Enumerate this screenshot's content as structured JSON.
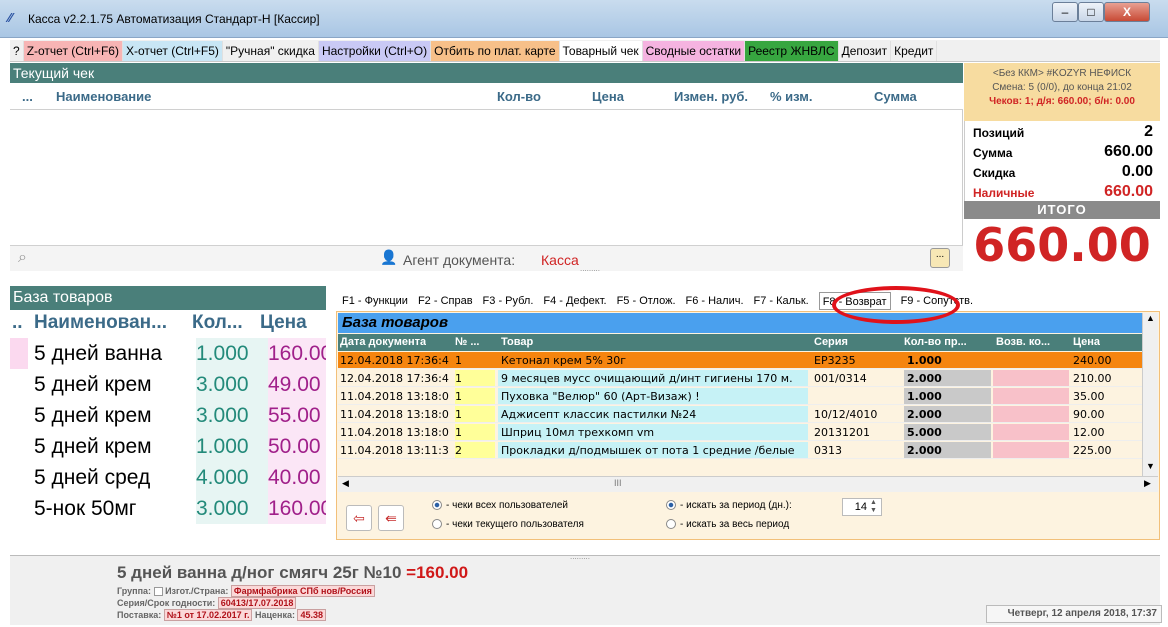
{
  "window": {
    "title": "Касса v2.2.1.75 Автоматизация Стандарт-Н [Кассир]",
    "icon": "app-logo-icon",
    "min": "–",
    "max": "□",
    "close": "X"
  },
  "toolbar": [
    {
      "label": "?",
      "color": "#f0f0f0"
    },
    {
      "label": "Z-отчет (Ctrl+F6)",
      "color": "#f7b4b4"
    },
    {
      "label": "X-отчет (Ctrl+F5)",
      "color": "#c8e6f5"
    },
    {
      "label": "\"Ручная\" скидка",
      "color": "#f0f0f0"
    },
    {
      "label": "Настройки (Ctrl+O)",
      "color": "#c9c9f5"
    },
    {
      "label": "Отбить по плат. карте",
      "color": "#f7c089"
    },
    {
      "label": "Товарный чек",
      "color": "#ffffff"
    },
    {
      "label": "Сводные остатки",
      "color": "#f5b3e0"
    },
    {
      "label": "Реестр ЖНВЛС",
      "color": "#37a640"
    },
    {
      "label": "Депозит",
      "color": "#f0f0f0"
    },
    {
      "label": "Кредит",
      "color": "#f0f0f0"
    }
  ],
  "current": {
    "title": "Текущий чек",
    "cols": {
      "dots": "...",
      "name": "Наименование",
      "qty": "Кол-во",
      "price": "Цена",
      "chg": "Измен. руб.",
      "pct": "% изм.",
      "sum": "Сумма"
    },
    "agent_label": "Агент документа:",
    "agent_value": "Касса",
    "more": "...",
    "splitter": "........."
  },
  "shift": {
    "line1": "<Без ККМ> #KOZYR НЕФИСК",
    "line2": "Смена: 5 (0/0), до конца 21:02",
    "line3": "Чеков: 1; д/я: 660.00; б/н: 0.00"
  },
  "totals": {
    "positions_l": "Позиций",
    "positions_v": "2",
    "sum_l": "Сумма",
    "sum_v": "660.00",
    "disc_l": "Скидка",
    "disc_v": "0.00",
    "cash_l": "Наличные",
    "cash_v": "660.00",
    "itogo_l": "ИТОГО",
    "itogo_v": "660.00"
  },
  "base": {
    "title": "База товаров",
    "cols": {
      "dots": "..",
      "name": "Наименован...",
      "qty": "Кол...",
      "price": "Цена"
    },
    "rows": [
      {
        "name": "5 дней ванна",
        "qty": "1.000",
        "price": "160.00"
      },
      {
        "name": "5 дней крем",
        "qty": "3.000",
        "price": "49.00"
      },
      {
        "name": "5 дней крем",
        "qty": "3.000",
        "price": "55.00"
      },
      {
        "name": "5 дней крем",
        "qty": "1.000",
        "price": "50.00"
      },
      {
        "name": "5 дней сред",
        "qty": "4.000",
        "price": "40.00"
      },
      {
        "name": "5-нок 50мг",
        "qty": "3.000",
        "price": "160.00"
      }
    ]
  },
  "fkeys": [
    "F1 - Функции",
    "F2 - Справ",
    "F3 - Рубл.",
    "F4 - Дефект.",
    "F5 - Отлож.",
    "F6 - Налич.",
    "F7 - Кальк.",
    "F8 - Возврат",
    "F9 - Сопутств."
  ],
  "returns": {
    "title": "База товаров",
    "cols": {
      "date": "Дата документа",
      "no": "№ ...",
      "name": "Товар",
      "series": "Серия",
      "qty": "Кол-во пр...",
      "ret": "Возв. ко...",
      "price": "Цена"
    },
    "rows": [
      {
        "date": "12.04.2018 17:36:4",
        "no": "1",
        "name": "Кетонал крем 5% 30г",
        "series": "EP3235",
        "qty": "1.000",
        "ret": "",
        "price": "240.00"
      },
      {
        "date": "12.04.2018 17:36:4",
        "no": "1",
        "name": "9 месяцев мусс очищающий д/инт гигиены 170 м.",
        "series": "001/0314",
        "qty": "2.000",
        "ret": "",
        "price": "210.00"
      },
      {
        "date": "11.04.2018 13:18:0",
        "no": "1",
        "name": "Пуховка \"Велюр\" 60 (Арт-Визаж) !",
        "series": "",
        "qty": "1.000",
        "ret": "",
        "price": "35.00"
      },
      {
        "date": "11.04.2018 13:18:0",
        "no": "1",
        "name": "Аджисепт классик пастилки №24",
        "series": "10/12/4010",
        "qty": "2.000",
        "ret": "",
        "price": "90.00"
      },
      {
        "date": "11.04.2018 13:18:0",
        "no": "1",
        "name": "Шприц 10мл трехкомп vm",
        "series": "20131201",
        "qty": "5.000",
        "ret": "",
        "price": "12.00"
      },
      {
        "date": "11.04.2018 13:11:3",
        "no": "2",
        "name": "Прокладки д/подмышек от пота 1 средние /белые",
        "series": "0313",
        "qty": "2.000",
        "ret": "",
        "price": "225.00"
      }
    ],
    "radio_all": "- чеки всех пользователей",
    "radio_cur": "- чеки текущего пользователя",
    "radio_period": "- искать за период (дн.):",
    "radio_whole": "- искать за весь период",
    "days": "14",
    "hscroll_mark": "III"
  },
  "info": {
    "name": "5 дней ванна д/ног смягч 25г №10",
    "price": "=160.00",
    "group_l": "Группа:",
    "maker_l": "Изгот./Страна:",
    "maker_v": "Фармфабрика СПб нов/Россия",
    "series_l": "Серия/Срок годности:",
    "series_v": "60413/17.07.2018",
    "supply_l": "Поставка:",
    "supply_v": "№1 от 17.02.2017 г.",
    "markup_l": "Наценка:",
    "markup_v": "45.38"
  },
  "status": {
    "datetime": "Четверг, 12 апреля 2018, 17:37"
  }
}
